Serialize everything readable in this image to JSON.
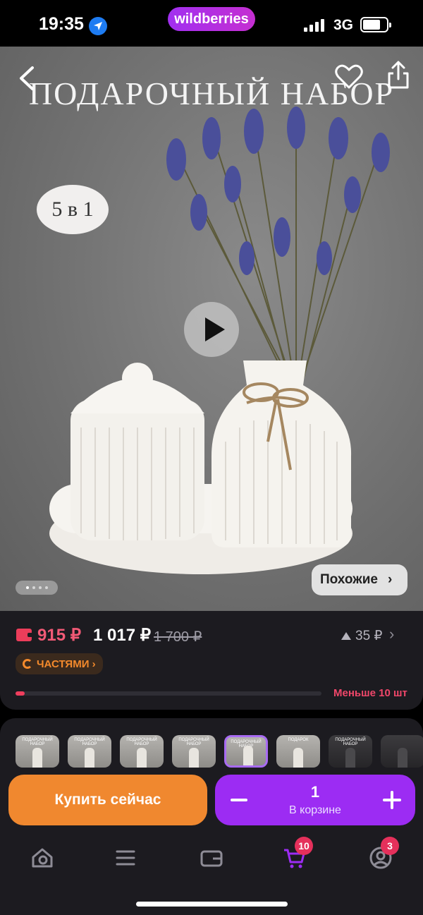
{
  "status_bar": {
    "time": "19:35",
    "brand": "wildberries",
    "network": "3G"
  },
  "product_image": {
    "title": "ПОДАРОЧНЫЙ НАБОР",
    "badge": "5 в 1",
    "similar_label": "Похожие",
    "similar_chevron": "›",
    "gallery_dots": 4,
    "active_dot": 0
  },
  "price": {
    "wallet_price": "915 ₽",
    "price": "1 017 ₽",
    "old_price": "1 700 ₽",
    "price_change": "35 ₽",
    "chevron": "›",
    "installments_label": "ЧАСТЯМИ ›",
    "stock_label": "Меньше 10 шт",
    "stock_level": 0.03
  },
  "variants": [
    {
      "caption": "ПОДАРОЧНЫЙ НАБОР",
      "dark": false,
      "selected": false
    },
    {
      "caption": "ПОДАРОЧНЫЙ НАБОР",
      "dark": false,
      "selected": false
    },
    {
      "caption": "ПОДАРОЧНЫЙ НАБОР",
      "dark": false,
      "selected": false
    },
    {
      "caption": "ПОДАРОЧНЫЙ НАБОР",
      "dark": false,
      "selected": false
    },
    {
      "caption": "ПОДАРОЧНЫЙ НАБОР",
      "dark": false,
      "selected": true
    },
    {
      "caption": "ПОДАРОК",
      "dark": false,
      "selected": false
    },
    {
      "caption": "ПОДАРОЧНЫЙ НАБОР",
      "dark": true,
      "selected": false
    },
    {
      "caption": "",
      "dark": true,
      "selected": false
    }
  ],
  "actions": {
    "buy_now": "Купить сейчас",
    "cart_quantity": "1",
    "cart_label": "В корзине"
  },
  "tab_bar": {
    "items": [
      {
        "name": "home",
        "icon": "search-home-icon"
      },
      {
        "name": "catalog",
        "icon": "menu-lines-icon"
      },
      {
        "name": "wallet",
        "icon": "wallet-icon"
      },
      {
        "name": "cart",
        "icon": "cart-icon",
        "badge": "10"
      },
      {
        "name": "profile",
        "icon": "profile-icon",
        "badge": "3"
      }
    ],
    "active": "cart",
    "active_color": "#9c2cf3"
  },
  "colors": {
    "accent": "#9c2cf3",
    "buy": "#f0882f",
    "price_wallet": "#f25a76",
    "stock": "#f0476a",
    "installments": "#f48a2c"
  }
}
